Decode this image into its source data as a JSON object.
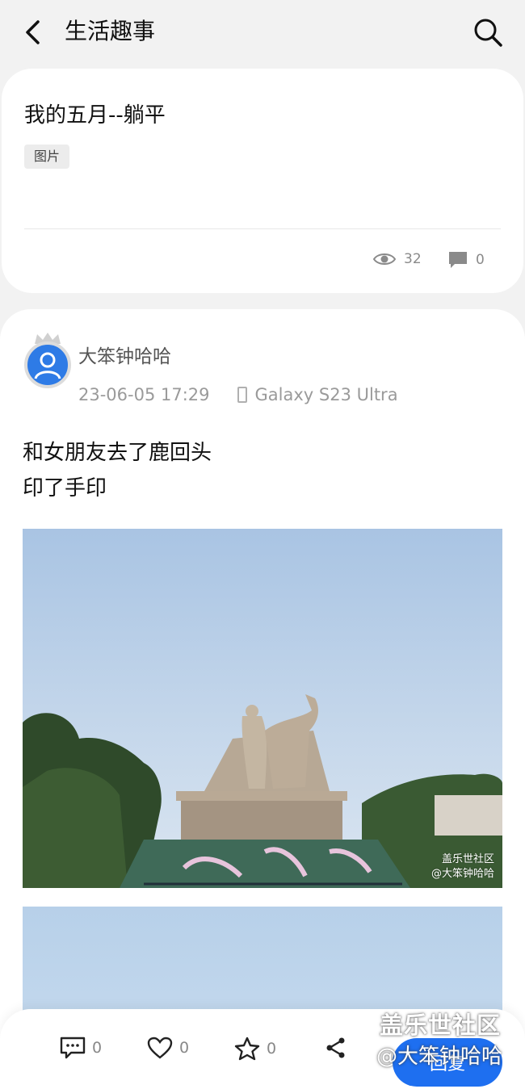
{
  "header": {
    "title": "生活趣事",
    "back_icon": "chevron-left-icon",
    "search_icon": "search-icon"
  },
  "post_summary": {
    "title": "我的五月--躺平",
    "tag": "图片",
    "views": "32",
    "comments": "0"
  },
  "post": {
    "username": "大笨钟哈哈",
    "timestamp": "23-06-05 17:29",
    "device": "Galaxy S23 Ultra",
    "body_lines": [
      "和女朋友去了鹿回头",
      "印了手印"
    ],
    "image1_watermark_site": "盖乐世社区",
    "image1_watermark_user": "@大笨钟哈哈"
  },
  "bottom_bar": {
    "comment_count": "0",
    "like_count": "0",
    "favorite_count": "0",
    "reply_label": "回复"
  },
  "overlay_watermark": {
    "site": "盖乐世社区",
    "user": "@大笨钟哈哈"
  },
  "colors": {
    "accent": "#1e6ff0",
    "background": "#f2f2f2",
    "avatar": "#2e7be6"
  }
}
